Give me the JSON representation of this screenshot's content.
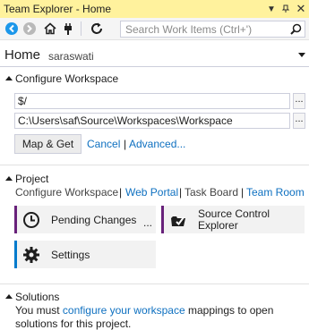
{
  "window": {
    "title": "Team Explorer - Home"
  },
  "toolbar": {
    "icons": [
      "back-icon",
      "forward-icon",
      "home-icon",
      "connect-icon",
      "refresh-icon"
    ],
    "search": {
      "placeholder": "Search Work Items (Ctrl+')",
      "value": ""
    }
  },
  "home": {
    "title": "Home",
    "user": "saraswati"
  },
  "configure_workspace": {
    "header": "Configure Workspace",
    "source_path": "$/",
    "local_path": "C:\\Users\\saf\\Source\\Workspaces\\Workspace",
    "browse_label": "...",
    "map_get_label": "Map & Get",
    "cancel_label": "Cancel",
    "advanced_label": "Advanced..."
  },
  "project": {
    "header": "Project",
    "links": {
      "configure_workspace": "Configure Workspace",
      "web_portal": "Web Portal",
      "task_board": "Task Board",
      "team_room": "Team Room",
      "separator": "|"
    },
    "tiles": {
      "pending_changes": {
        "label": "Pending Changes",
        "more": "...",
        "accent": "#68217a",
        "icon": "clock-icon"
      },
      "source_control_explorer": {
        "label_line1": "Source Control",
        "label_line2": "Explorer",
        "accent": "#68217a",
        "icon": "source-control-icon"
      },
      "settings": {
        "label": "Settings",
        "accent": "#007acc",
        "icon": "gear-icon"
      }
    }
  },
  "solutions": {
    "header": "Solutions",
    "text_before": "You must ",
    "link": "configure your workspace",
    "text_after": " mappings to open solutions for this project."
  },
  "colors": {
    "title_bar": "#fff29d",
    "link": "#0e70c0",
    "accent_purple": "#68217a",
    "accent_blue": "#007acc"
  }
}
